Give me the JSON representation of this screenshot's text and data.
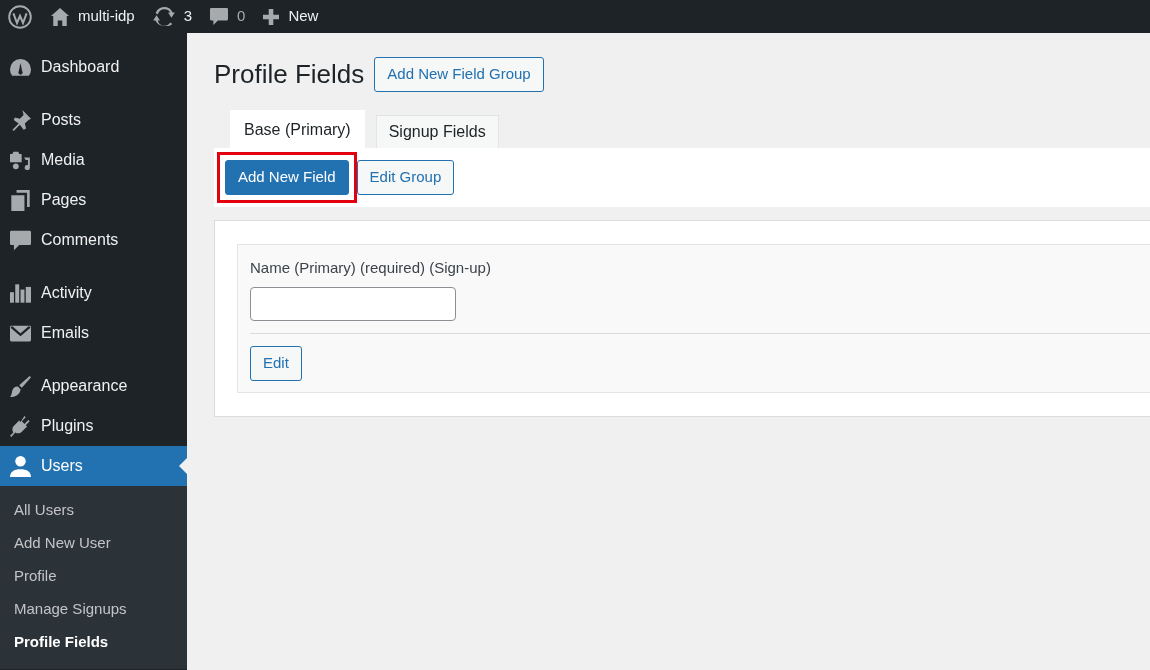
{
  "admin_bar": {
    "site": {
      "label": "multi-idp"
    },
    "updates": {
      "count": "3"
    },
    "comments": {
      "count": "0"
    },
    "new_content": {
      "label": "New"
    }
  },
  "sidebar": {
    "groups": [
      {
        "items": [
          {
            "label": "Dashboard",
            "selected": false
          }
        ]
      },
      {
        "items": [
          {
            "label": "Posts",
            "selected": false
          },
          {
            "label": "Media",
            "selected": false
          },
          {
            "label": "Pages",
            "selected": false
          },
          {
            "label": "Comments",
            "selected": false
          }
        ]
      },
      {
        "items": [
          {
            "label": "Activity",
            "selected": false
          },
          {
            "label": "Emails",
            "selected": false
          }
        ]
      },
      {
        "items": [
          {
            "label": "Appearance",
            "selected": false
          },
          {
            "label": "Plugins",
            "selected": false
          },
          {
            "label": "Users",
            "selected": true,
            "children": [
              {
                "label": "All Users",
                "selected": false
              },
              {
                "label": "Add New User",
                "selected": false
              },
              {
                "label": "Profile",
                "selected": false
              },
              {
                "label": "Manage Signups",
                "selected": false
              },
              {
                "label": "Profile Fields",
                "selected": true
              }
            ]
          }
        ]
      }
    ]
  },
  "page": {
    "title": "Profile Fields",
    "title_button": "Add New Field Group"
  },
  "tabs": [
    {
      "label": "Base (Primary)",
      "selected": true
    },
    {
      "label": "Signup Fields",
      "selected": false
    }
  ],
  "toolbar": {
    "buttons": [
      {
        "label": "Add New Field",
        "kind": "primary",
        "highlighted": true
      },
      {
        "label": "Edit Group",
        "kind": "secondary",
        "highlighted": false
      }
    ]
  },
  "fields": [
    {
      "label": "Name (Primary) (required) (Sign-up)",
      "edit_button": "Edit"
    }
  ]
}
